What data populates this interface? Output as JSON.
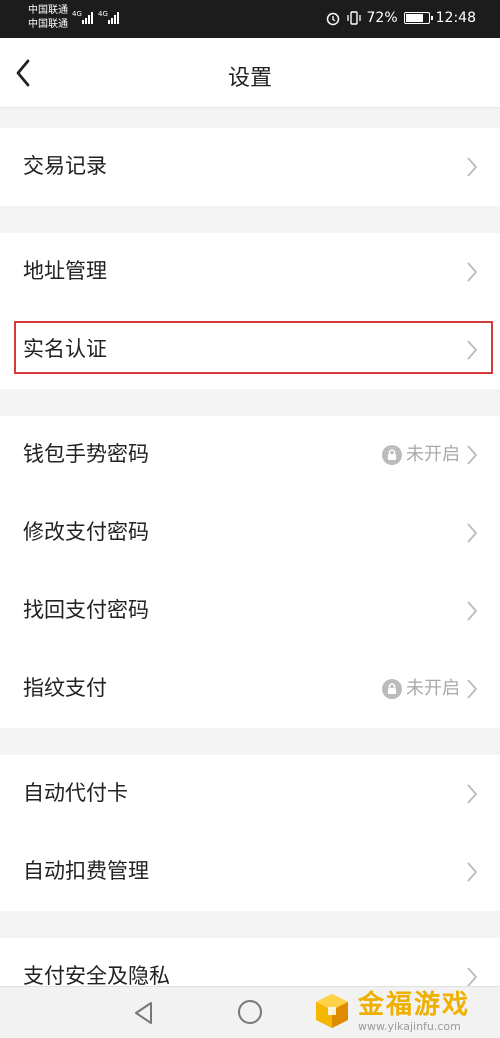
{
  "status_bar": {
    "carrier1": "中国联通",
    "carrier2": "中国联通",
    "net1": "4G",
    "net2": "4G",
    "battery": "72%",
    "time": "12:48"
  },
  "header": {
    "title": "设置"
  },
  "items": [
    {
      "label": "交易记录",
      "status": ""
    },
    {
      "label": "地址管理",
      "status": ""
    },
    {
      "label": "实名认证",
      "status": ""
    },
    {
      "label": "钱包手势密码",
      "status": "未开启"
    },
    {
      "label": "修改支付密码",
      "status": ""
    },
    {
      "label": "找回支付密码",
      "status": ""
    },
    {
      "label": "指纹支付",
      "status": "未开启"
    },
    {
      "label": "自动代付卡",
      "status": ""
    },
    {
      "label": "自动扣费管理",
      "status": ""
    },
    {
      "label": "支付安全及隐私",
      "status": ""
    }
  ],
  "watermark": {
    "title": "金福游戏",
    "url": "www.yikajinfu.com"
  },
  "colors": {
    "highlight_border": "#d43a3a",
    "status_text": "#aaaaaa",
    "watermark": "#f0b000"
  }
}
